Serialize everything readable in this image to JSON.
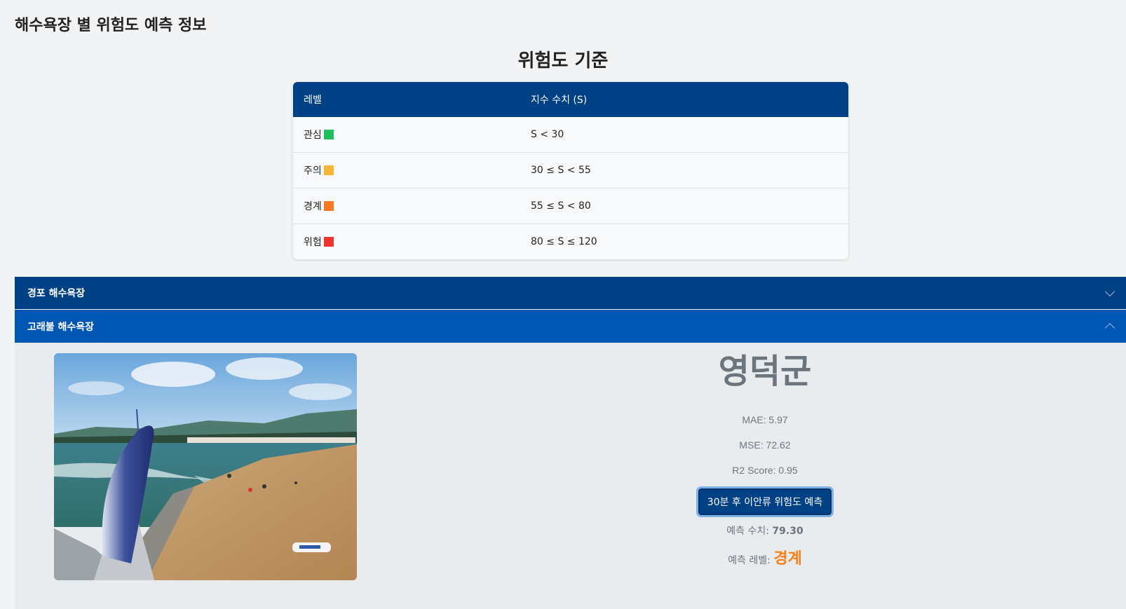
{
  "page": {
    "heading": "해수욕장 별 위험도 예측 정보"
  },
  "criteria": {
    "title": "위험도 기준",
    "headers": [
      "레벨",
      "지수 수치 (S)"
    ],
    "rows": [
      {
        "level": "관심",
        "range": "S < 30",
        "color": "#20c05c"
      },
      {
        "level": "주의",
        "range": "30 ≤ S < 55",
        "color": "#f7b633"
      },
      {
        "level": "경계",
        "range": "55 ≤ S < 80",
        "color": "#f57a22"
      },
      {
        "level": "위험",
        "range": "80 ≤ S ≤ 120",
        "color": "#ee3434"
      }
    ]
  },
  "beaches": [
    {
      "name": "경포 해수욕장",
      "expanded": false
    },
    {
      "name": "고래불 해수욕장",
      "expanded": true,
      "region": "영덕군",
      "mae": "MAE: 5.97",
      "mse": "MSE: 72.62",
      "r2": "R2 Score: 0.95",
      "predict_button": "30분 후 이안류 위험도 예측",
      "pred_value_label": "예측 수치:",
      "pred_value": "79.30",
      "pred_level_label": "예측 레벨:",
      "pred_level": "경계",
      "pred_level_color": "#fd7e14"
    }
  ]
}
